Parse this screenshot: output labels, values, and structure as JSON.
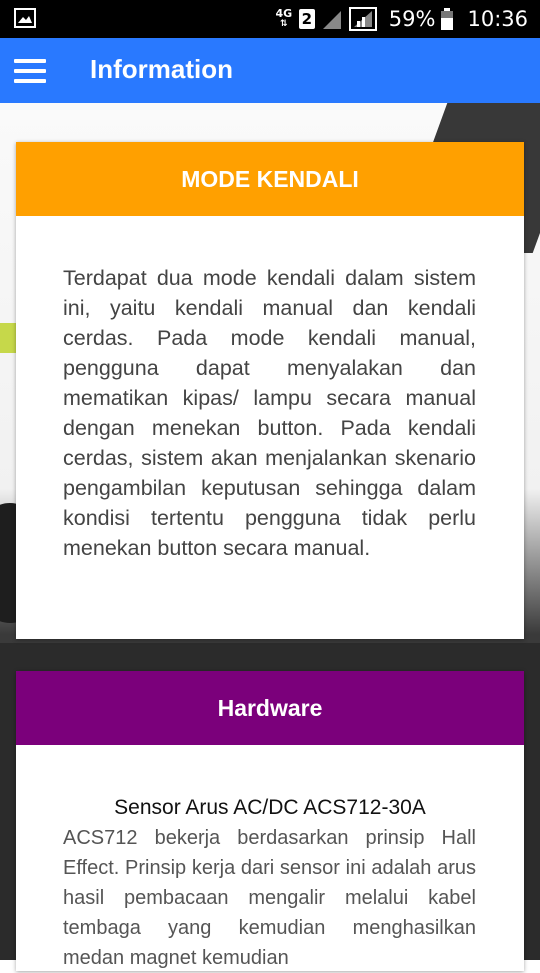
{
  "status_bar": {
    "network": "4G",
    "sim": "2",
    "battery": "59%",
    "time": "10:36"
  },
  "app_bar": {
    "title": "Information"
  },
  "cards": [
    {
      "header": "MODE KENDALI",
      "header_color": "#ffa000",
      "body": "Terdapat dua mode kendali dalam sistem ini, yaitu kendali manual dan kendali cerdas. Pada mode kendali manual, pengguna dapat menyalakan dan mematikan kipas/ lampu secara manual dengan menekan button. Pada kendali cerdas, sistem akan menjalankan skenario pengambilan keputusan sehingga dalam kondisi tertentu pengguna tidak perlu menekan button secara manual."
    },
    {
      "header": "Hardware",
      "header_color": "#7b007b",
      "subtitle": "Sensor Arus AC/DC ACS712-30A",
      "body": "ACS712 bekerja berdasarkan prinsip Hall Effect. Prinsip kerja dari sensor ini adalah arus hasil pembacaan mengalir melalui kabel tembaga yang kemudian menghasilkan medan magnet kemudian"
    }
  ],
  "colors": {
    "app_bar": "#2979ff",
    "status_bar": "#000000"
  }
}
